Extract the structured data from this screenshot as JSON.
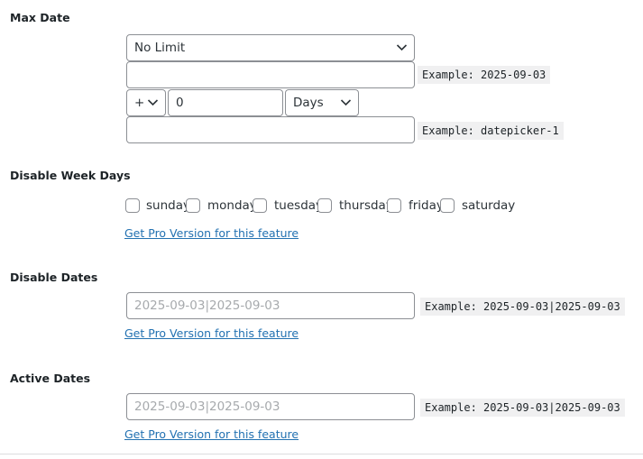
{
  "max_date": {
    "label": "Max Date",
    "limit_select": "No Limit",
    "date_input_value": "",
    "date_example": "Example: 2025-09-03",
    "sign_select": "+",
    "offset_value": "0",
    "unit_select": "Days",
    "field_input_value": "",
    "field_example": "Example: datepicker-1"
  },
  "disable_week_days": {
    "label": "Disable Week Days",
    "days": [
      "sunday",
      "monday",
      "tuesday",
      "thursday",
      "friday",
      "saturday"
    ],
    "pro_link": "Get Pro Version for this feature"
  },
  "disable_dates": {
    "label": "Disable Dates",
    "placeholder": "2025-09-03|2025-09-03",
    "example": "Example: 2025-09-03|2025-09-03",
    "pro_link": "Get Pro Version for this feature"
  },
  "active_dates": {
    "label": "Active Dates",
    "placeholder": "2025-09-03|2025-09-03",
    "example": "Example: 2025-09-03|2025-09-03",
    "pro_link": "Get Pro Version for this feature"
  }
}
